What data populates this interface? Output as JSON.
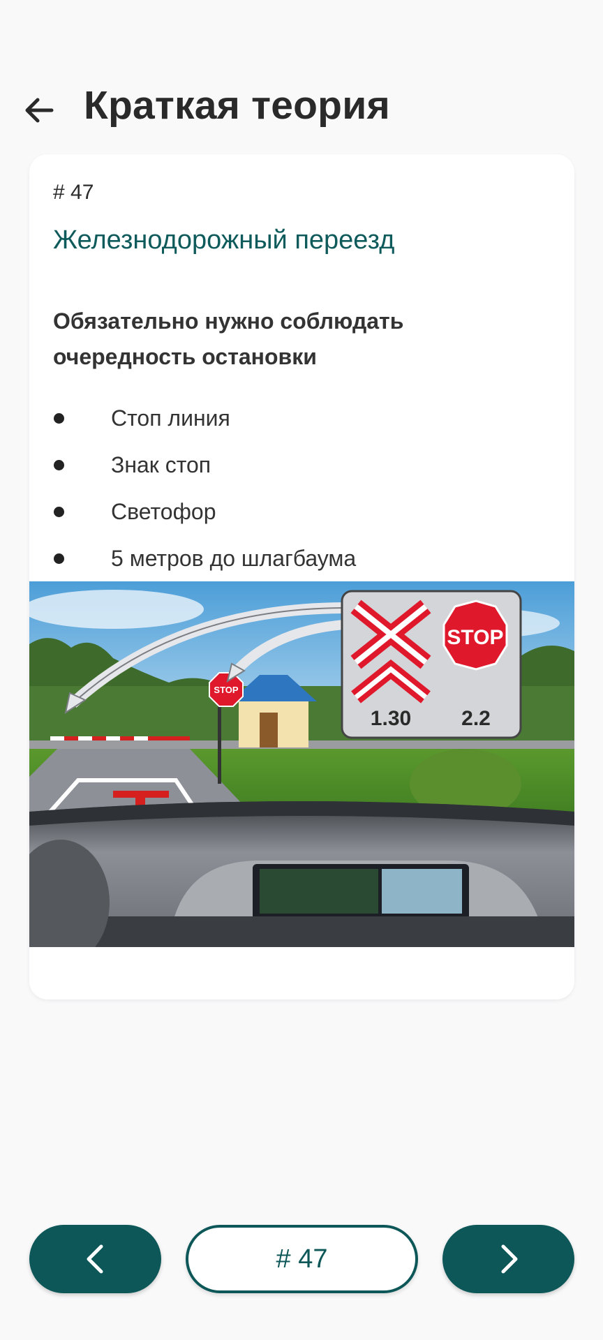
{
  "header": {
    "title": "Краткая теория",
    "back_icon": "arrow-left-icon"
  },
  "card": {
    "number": "# 47",
    "heading": "Железнодорожный переезд",
    "lead": "Обязательно нужно соблюдать очередность остановки",
    "bullets": [
      "Стоп линия",
      "Знак стоп",
      "Светофор",
      "5 метров до шлагбаума"
    ],
    "illustration": {
      "sign_left_code": "1.30",
      "sign_right_code": "2.2",
      "stop_text": "STOP"
    }
  },
  "nav": {
    "prev_icon": "chevron-left-icon",
    "counter_label": "# 47",
    "next_icon": "chevron-right-icon"
  },
  "colors": {
    "accent": "#0d5758",
    "heading": "#0f5a5b",
    "background": "#f9f9fa"
  }
}
